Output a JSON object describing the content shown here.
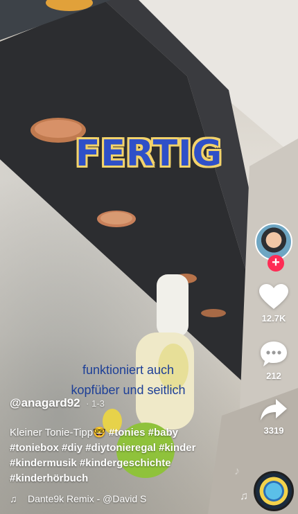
{
  "overlay": {
    "title": "FERTIG",
    "caption_line1": "funktioniert auch",
    "caption_line2": "kopfüber und seitlich"
  },
  "post": {
    "username": "@anagard92",
    "date": "· 1-3",
    "description_lead": "Kleiner Tonie-Tipp🤓",
    "hashtags_line1": [
      "#tonies",
      "#baby"
    ],
    "hashtags_line2": [
      "#toniebox",
      "#diy",
      "#diytonieregal",
      "#kinder"
    ],
    "hashtags_line3": [
      "#kindermusik",
      "#kindergeschichte"
    ],
    "hashtags_line4": [
      "#kinderhörbuch"
    ],
    "sound": "Dante9k Remix - @David S"
  },
  "actions": {
    "likes": "12.7K",
    "comments": "212",
    "shares": "3319"
  },
  "icons": {
    "like": "heart-icon",
    "comment": "comment-icon",
    "share": "share-arrow-icon",
    "music": "music-note-icon",
    "follow": "plus-icon"
  },
  "colors": {
    "fertig_text": "#2f50c8",
    "fertig_outline": "#f3d36b",
    "caption_text": "#1d3f97",
    "follow_red": "#fe2c55"
  }
}
